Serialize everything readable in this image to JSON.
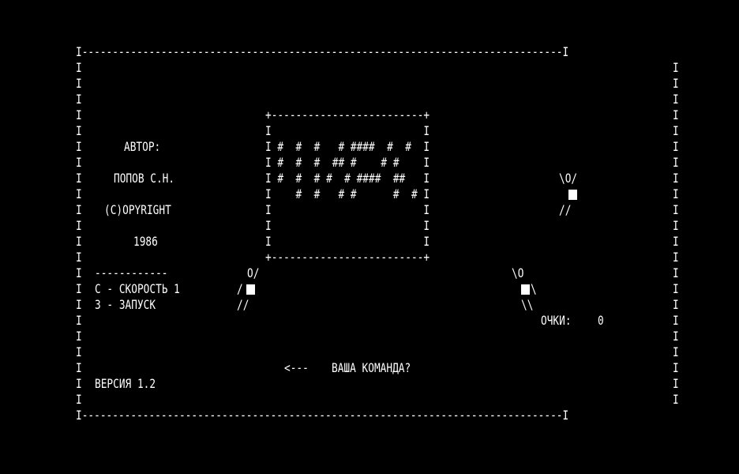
{
  "colors": {
    "background": "#000000",
    "foreground": "#ffffff"
  },
  "frame": {
    "top_border": "I-------------------------------------------------------------------------------I",
    "bottom_border": "I-------------------------------------------------------------------------------I",
    "side_char": "I"
  },
  "credits": {
    "author_label": "АВТОР:",
    "author_name": "ПОПОВ С.Н.",
    "copyright": "(С)OPYRIGHT",
    "year": "1986"
  },
  "logo_box": {
    "top": "+-------------------------+",
    "bottom": "+-------------------------+",
    "rows": [
      "I                         I",
      "I #  #  #   # ####  #  #  I",
      "I #  #  #  ## #    # #    I",
      "I #  #  # #  # ####  ##   I",
      "I    #  #   # #      #  # I",
      "I                         I",
      "I                         I",
      "I                         I"
    ]
  },
  "menu": {
    "separator": "------------",
    "speed_option": "С - СКОРОСТЬ 1",
    "start_option": "З - ЗАПУСК"
  },
  "figures": {
    "right_top": {
      "head": "\\O/",
      "legs": "//",
      "icon": "stick-figure-arms-up-icon"
    },
    "left": {
      "head": "O/",
      "arm": "/",
      "legs": "//",
      "icon": "stick-figure-left-icon"
    },
    "right_bottom": {
      "head": "\\O",
      "arm": "\\",
      "legs": "\\\\",
      "icon": "stick-figure-right-icon"
    }
  },
  "score": {
    "label": "ОЧКИ:",
    "value": "0"
  },
  "prompt": {
    "arrow": "<---",
    "text": "ВАША КОМАНДА?"
  },
  "version": "ВЕРСИЯ 1.2"
}
